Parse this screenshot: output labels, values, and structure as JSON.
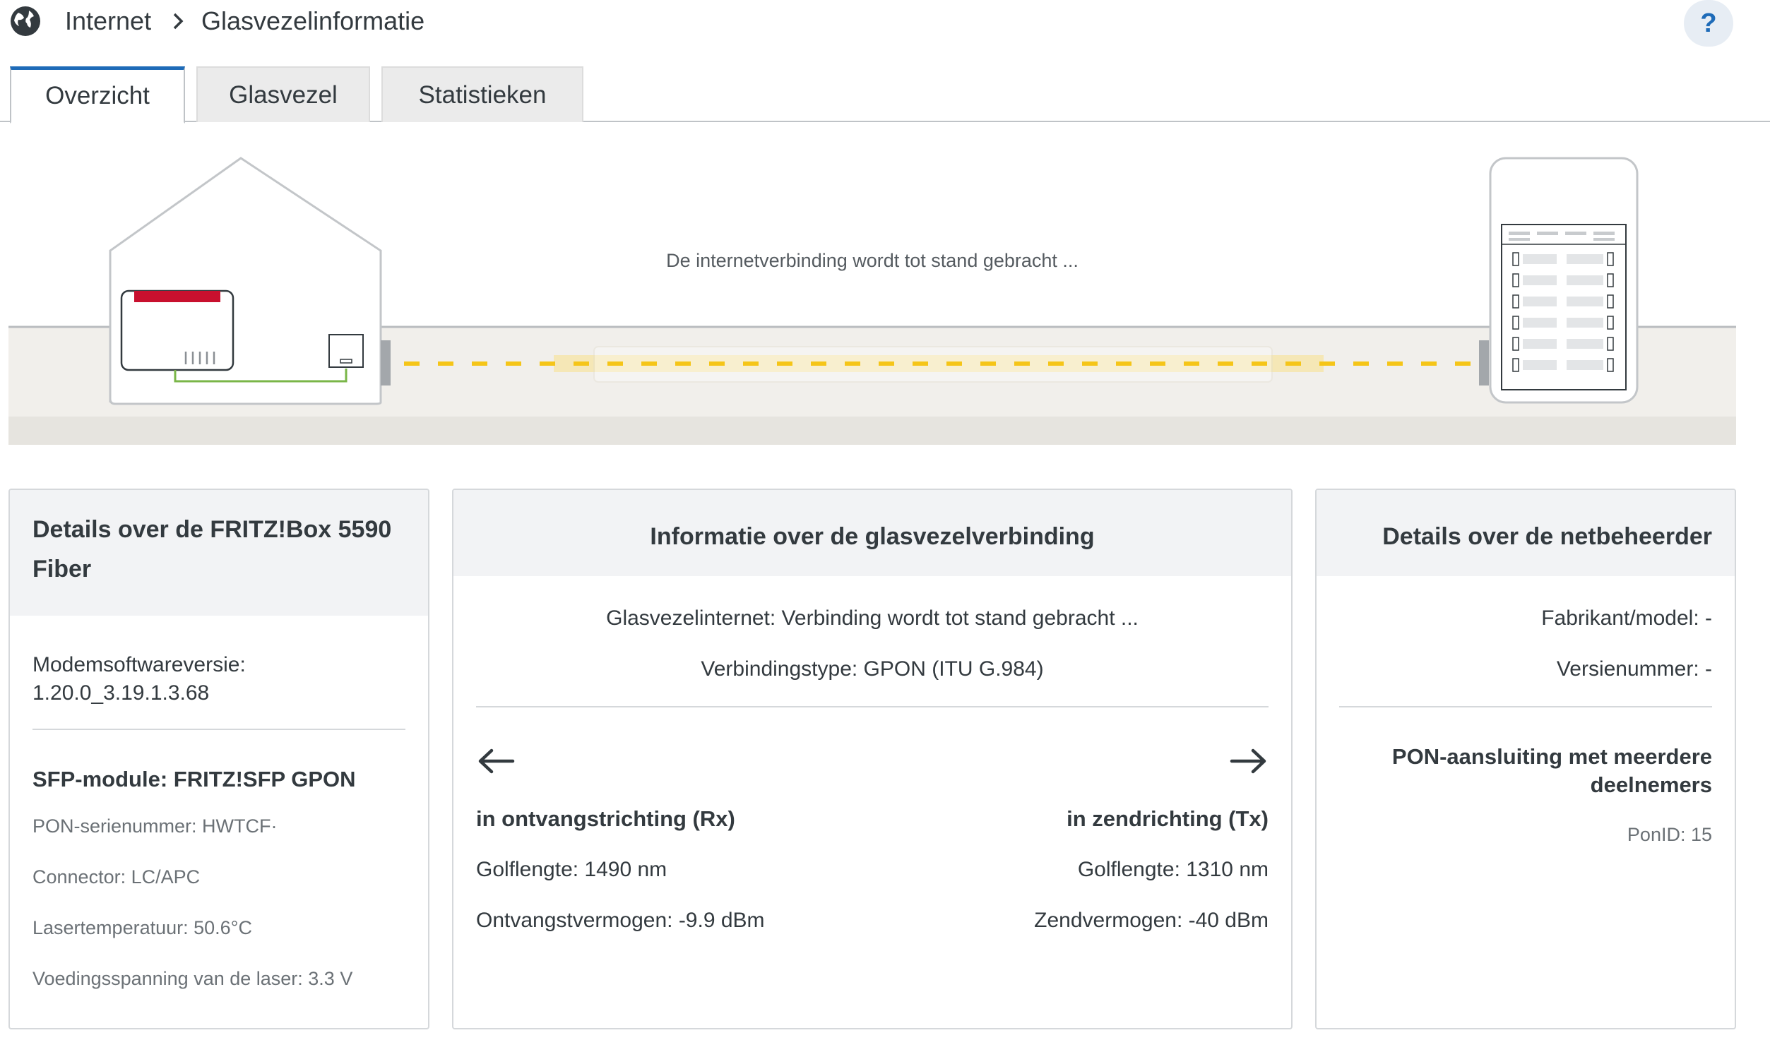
{
  "breadcrumb": {
    "icon": "globe-icon",
    "level1": "Internet",
    "level2": "Glasvezelinformatie"
  },
  "help": {
    "label": "?"
  },
  "tabs": [
    {
      "label": "Overzicht",
      "active": true
    },
    {
      "label": "Glasvezel",
      "active": false
    },
    {
      "label": "Statistieken",
      "active": false
    }
  ],
  "diagram": {
    "status": "De internetverbinding wordt tot stand gebracht ..."
  },
  "device": {
    "title": "Details over de FRITZ!Box 5590 Fiber",
    "firmware_label": "Modemsoftwareversie:",
    "firmware_value": "1.20.0_3.19.1.3.68",
    "sfp_title": "SFP-module: FRITZ!SFP GPON",
    "rows": [
      "PON-serienummer: HWTCF·",
      "Connector: LC/APC",
      "Lasertemperatuur: 50.6°C",
      "Voedingsspanning van de laser: 3.3 V"
    ]
  },
  "fiber": {
    "title": "Informatie over de glasvezelverbinding",
    "status": "Glasvezelinternet: Verbinding wordt tot stand gebracht ...",
    "type": "Verbindingstype: GPON (ITU G.984)",
    "rx": {
      "title": "in ontvangstrichting (Rx)",
      "wavelength": "Golflengte: 1490 nm",
      "power": "Ontvangstvermogen: -9.9 dBm"
    },
    "tx": {
      "title": "in zendrichting (Tx)",
      "wavelength": "Golflengte: 1310 nm",
      "power": "Zendvermogen: -40 dBm"
    }
  },
  "operator": {
    "title": "Details over de netbeheerder",
    "model": "Fabrikant/model: -",
    "version": "Versienummer: -",
    "pon_title": "PON-aansluiting met meerdere deelnemers",
    "pon_id": "PonID: 15"
  },
  "colors": {
    "accent": "#1e6bb8",
    "fiber_line": "#f5c518",
    "router_red": "#c8102e",
    "cable_green": "#7ab648"
  }
}
